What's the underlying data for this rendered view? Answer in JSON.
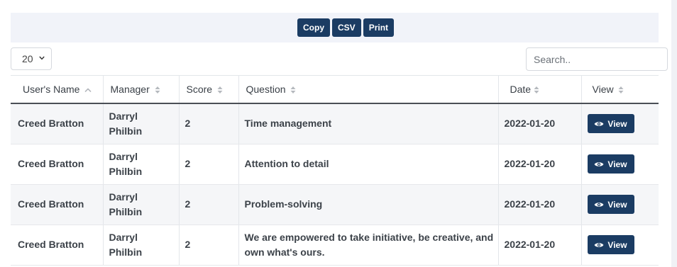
{
  "toolbar": {
    "copy_label": "Copy",
    "csv_label": "CSV",
    "print_label": "Print"
  },
  "length_select": {
    "value": "20"
  },
  "search": {
    "placeholder": "Search.."
  },
  "table": {
    "columns": [
      "User's Name",
      "Manager",
      "Score",
      "Question",
      "Date",
      "View"
    ],
    "rows": [
      {
        "user": "Creed Bratton",
        "manager_first": "Darryl",
        "manager_last": "Philbin",
        "score": "2",
        "question_line1": "Time management",
        "question_line2": "",
        "date": "2022-01-20",
        "view_label": "View"
      },
      {
        "user": "Creed Bratton",
        "manager_first": "Darryl",
        "manager_last": "Philbin",
        "score": "2",
        "question_line1": "Attention to detail",
        "question_line2": "",
        "date": "2022-01-20",
        "view_label": "View"
      },
      {
        "user": "Creed Bratton",
        "manager_first": "Darryl",
        "manager_last": "Philbin",
        "score": "2",
        "question_line1": "Problem-solving",
        "question_line2": "",
        "date": "2022-01-20",
        "view_label": "View"
      },
      {
        "user": "Creed Bratton",
        "manager_first": "Darryl",
        "manager_last": "Philbin",
        "score": "2",
        "question_line1": "We are empowered to take initiative, be creative, and",
        "question_line2": "own what's ours.",
        "date": "2022-01-20",
        "view_label": "View"
      }
    ]
  },
  "icons": {
    "sort_active": "sort-ascending-icon",
    "sort": "sort-icon",
    "view": "eye-icon",
    "select": "chevron-down-icon"
  },
  "colors": {
    "primary_button": "#1b3c63",
    "date_text": "#e5973a",
    "toolbar_bg": "#f1f3f9",
    "striped_row": "#f5f6f8"
  }
}
